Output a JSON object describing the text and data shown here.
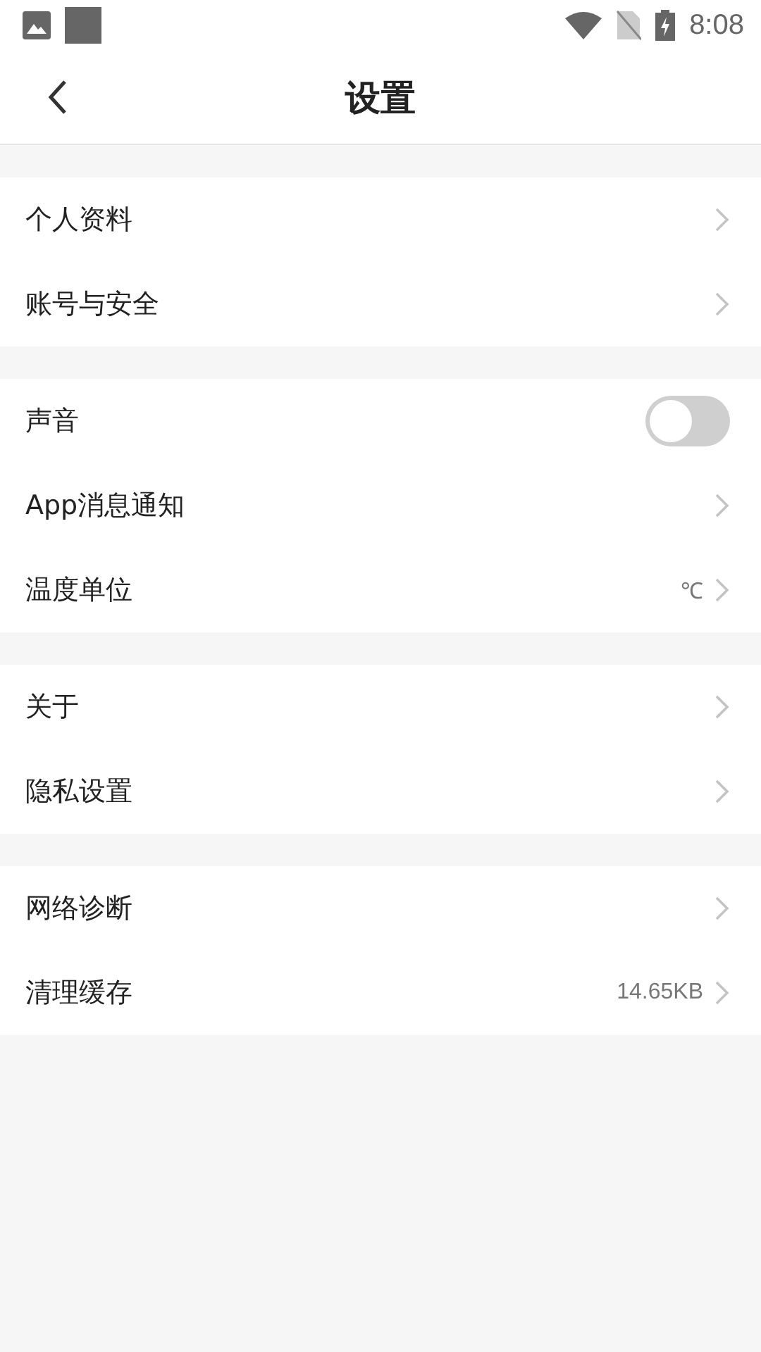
{
  "status_bar": {
    "time": "8:08"
  },
  "header": {
    "title": "设置"
  },
  "groups": [
    {
      "rows": [
        {
          "kind": "link",
          "label": "个人资料"
        },
        {
          "kind": "link",
          "label": "账号与安全"
        }
      ]
    },
    {
      "rows": [
        {
          "kind": "toggle",
          "label": "声音",
          "on": false
        },
        {
          "kind": "link",
          "label": "App消息通知"
        },
        {
          "kind": "link",
          "label": "温度单位",
          "value": "℃"
        }
      ]
    },
    {
      "rows": [
        {
          "kind": "link",
          "label": "关于"
        },
        {
          "kind": "link",
          "label": "隐私设置"
        }
      ]
    },
    {
      "rows": [
        {
          "kind": "link",
          "label": "网络诊断"
        },
        {
          "kind": "link",
          "label": "清理缓存",
          "value": "14.65KB"
        }
      ]
    }
  ]
}
